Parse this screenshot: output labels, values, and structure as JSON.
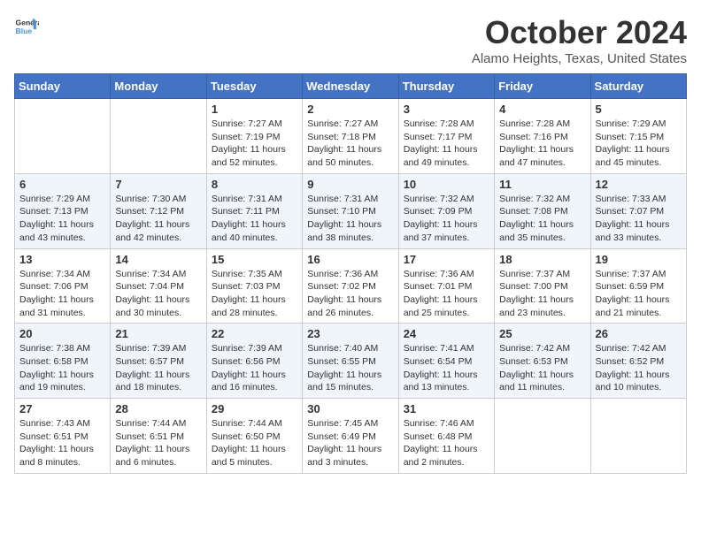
{
  "header": {
    "logo_line1": "General",
    "logo_line2": "Blue",
    "month": "October 2024",
    "location": "Alamo Heights, Texas, United States"
  },
  "weekdays": [
    "Sunday",
    "Monday",
    "Tuesday",
    "Wednesday",
    "Thursday",
    "Friday",
    "Saturday"
  ],
  "weeks": [
    [
      {
        "day": "",
        "info": ""
      },
      {
        "day": "",
        "info": ""
      },
      {
        "day": "1",
        "info": "Sunrise: 7:27 AM\nSunset: 7:19 PM\nDaylight: 11 hours and 52 minutes."
      },
      {
        "day": "2",
        "info": "Sunrise: 7:27 AM\nSunset: 7:18 PM\nDaylight: 11 hours and 50 minutes."
      },
      {
        "day": "3",
        "info": "Sunrise: 7:28 AM\nSunset: 7:17 PM\nDaylight: 11 hours and 49 minutes."
      },
      {
        "day": "4",
        "info": "Sunrise: 7:28 AM\nSunset: 7:16 PM\nDaylight: 11 hours and 47 minutes."
      },
      {
        "day": "5",
        "info": "Sunrise: 7:29 AM\nSunset: 7:15 PM\nDaylight: 11 hours and 45 minutes."
      }
    ],
    [
      {
        "day": "6",
        "info": "Sunrise: 7:29 AM\nSunset: 7:13 PM\nDaylight: 11 hours and 43 minutes."
      },
      {
        "day": "7",
        "info": "Sunrise: 7:30 AM\nSunset: 7:12 PM\nDaylight: 11 hours and 42 minutes."
      },
      {
        "day": "8",
        "info": "Sunrise: 7:31 AM\nSunset: 7:11 PM\nDaylight: 11 hours and 40 minutes."
      },
      {
        "day": "9",
        "info": "Sunrise: 7:31 AM\nSunset: 7:10 PM\nDaylight: 11 hours and 38 minutes."
      },
      {
        "day": "10",
        "info": "Sunrise: 7:32 AM\nSunset: 7:09 PM\nDaylight: 11 hours and 37 minutes."
      },
      {
        "day": "11",
        "info": "Sunrise: 7:32 AM\nSunset: 7:08 PM\nDaylight: 11 hours and 35 minutes."
      },
      {
        "day": "12",
        "info": "Sunrise: 7:33 AM\nSunset: 7:07 PM\nDaylight: 11 hours and 33 minutes."
      }
    ],
    [
      {
        "day": "13",
        "info": "Sunrise: 7:34 AM\nSunset: 7:06 PM\nDaylight: 11 hours and 31 minutes."
      },
      {
        "day": "14",
        "info": "Sunrise: 7:34 AM\nSunset: 7:04 PM\nDaylight: 11 hours and 30 minutes."
      },
      {
        "day": "15",
        "info": "Sunrise: 7:35 AM\nSunset: 7:03 PM\nDaylight: 11 hours and 28 minutes."
      },
      {
        "day": "16",
        "info": "Sunrise: 7:36 AM\nSunset: 7:02 PM\nDaylight: 11 hours and 26 minutes."
      },
      {
        "day": "17",
        "info": "Sunrise: 7:36 AM\nSunset: 7:01 PM\nDaylight: 11 hours and 25 minutes."
      },
      {
        "day": "18",
        "info": "Sunrise: 7:37 AM\nSunset: 7:00 PM\nDaylight: 11 hours and 23 minutes."
      },
      {
        "day": "19",
        "info": "Sunrise: 7:37 AM\nSunset: 6:59 PM\nDaylight: 11 hours and 21 minutes."
      }
    ],
    [
      {
        "day": "20",
        "info": "Sunrise: 7:38 AM\nSunset: 6:58 PM\nDaylight: 11 hours and 19 minutes."
      },
      {
        "day": "21",
        "info": "Sunrise: 7:39 AM\nSunset: 6:57 PM\nDaylight: 11 hours and 18 minutes."
      },
      {
        "day": "22",
        "info": "Sunrise: 7:39 AM\nSunset: 6:56 PM\nDaylight: 11 hours and 16 minutes."
      },
      {
        "day": "23",
        "info": "Sunrise: 7:40 AM\nSunset: 6:55 PM\nDaylight: 11 hours and 15 minutes."
      },
      {
        "day": "24",
        "info": "Sunrise: 7:41 AM\nSunset: 6:54 PM\nDaylight: 11 hours and 13 minutes."
      },
      {
        "day": "25",
        "info": "Sunrise: 7:42 AM\nSunset: 6:53 PM\nDaylight: 11 hours and 11 minutes."
      },
      {
        "day": "26",
        "info": "Sunrise: 7:42 AM\nSunset: 6:52 PM\nDaylight: 11 hours and 10 minutes."
      }
    ],
    [
      {
        "day": "27",
        "info": "Sunrise: 7:43 AM\nSunset: 6:51 PM\nDaylight: 11 hours and 8 minutes."
      },
      {
        "day": "28",
        "info": "Sunrise: 7:44 AM\nSunset: 6:51 PM\nDaylight: 11 hours and 6 minutes."
      },
      {
        "day": "29",
        "info": "Sunrise: 7:44 AM\nSunset: 6:50 PM\nDaylight: 11 hours and 5 minutes."
      },
      {
        "day": "30",
        "info": "Sunrise: 7:45 AM\nSunset: 6:49 PM\nDaylight: 11 hours and 3 minutes."
      },
      {
        "day": "31",
        "info": "Sunrise: 7:46 AM\nSunset: 6:48 PM\nDaylight: 11 hours and 2 minutes."
      },
      {
        "day": "",
        "info": ""
      },
      {
        "day": "",
        "info": ""
      }
    ]
  ]
}
